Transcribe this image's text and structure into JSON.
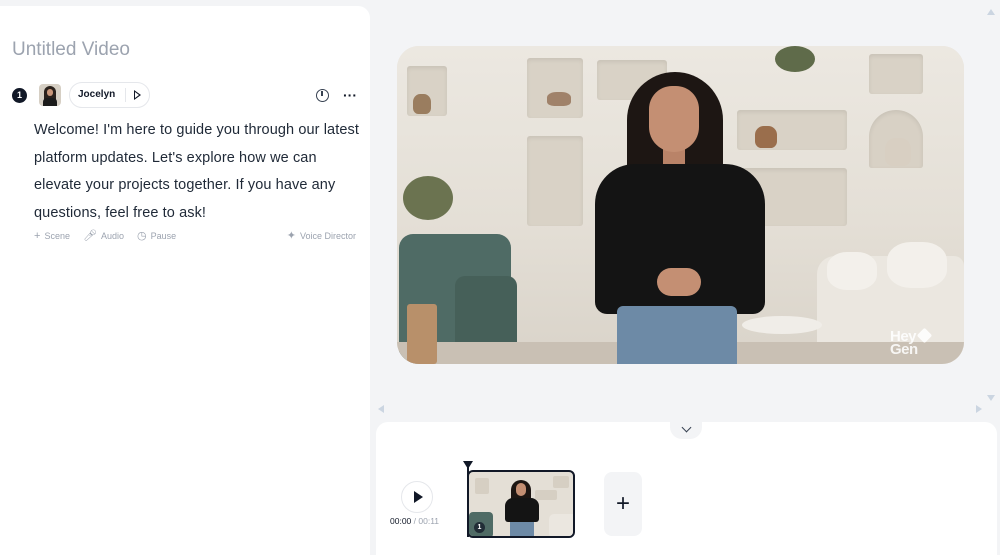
{
  "editor": {
    "title": "Untitled Video"
  },
  "scene": {
    "number": "1",
    "voice_name": "Jocelyn",
    "script": "Welcome! I'm here to guide you through our latest platform updates. Let's explore how we can elevate your projects together. If you have any questions, feel free to ask!",
    "tools": {
      "scene_label": "Scene",
      "audio_label": "Audio",
      "pause_label": "Pause",
      "voice_director_label": "Voice Director"
    }
  },
  "preview": {
    "watermark_line1": "Hey",
    "watermark_line2": "Gen"
  },
  "timeline": {
    "current_time": "00:00",
    "separator": " / ",
    "total_time": "00:11",
    "clip_number": "1",
    "add_scene_symbol": "+"
  },
  "icons": {
    "timer": "timer-icon",
    "more": "more-options-icon",
    "play": "play-icon",
    "add": "plus-icon"
  }
}
